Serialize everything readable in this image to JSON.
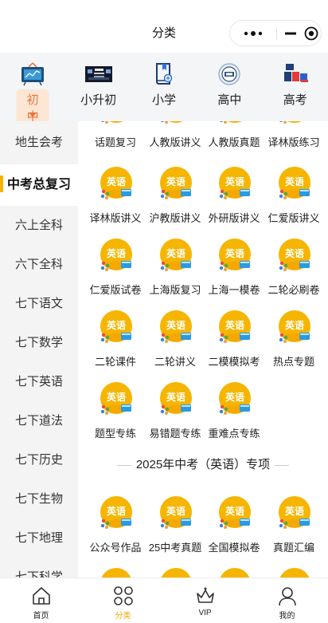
{
  "header": {
    "title": "分类"
  },
  "categories": [
    {
      "label": "初中",
      "icon": "blackboard-icon",
      "active": true
    },
    {
      "label": "小升初",
      "icon": "banner-image-icon"
    },
    {
      "label": "小学",
      "icon": "book-icon"
    },
    {
      "label": "高中",
      "icon": "high-school-icon"
    },
    {
      "label": "高考",
      "icon": "gaokao-icon"
    }
  ],
  "sidebar": {
    "items": [
      {
        "label": "地生会考"
      },
      {
        "label": "中考总复习",
        "active": true
      },
      {
        "label": "六上全科"
      },
      {
        "label": "六下全科"
      },
      {
        "label": "七下语文"
      },
      {
        "label": "七下数学"
      },
      {
        "label": "七下英语"
      },
      {
        "label": "七下道法"
      },
      {
        "label": "七下历史"
      },
      {
        "label": "七下生物"
      },
      {
        "label": "七下地理"
      },
      {
        "label": "七下科学"
      }
    ]
  },
  "main": {
    "badge_text": "英语",
    "top_partial_labels": [
      "话题复习",
      "人教版讲义",
      "人教版真题",
      "译林版练习"
    ],
    "tiles": [
      "译林版讲义",
      "沪教版讲义",
      "外研版讲义",
      "仁爱版讲义",
      "仁爱版试卷",
      "上海版复习",
      "上海一模卷",
      "二轮必刷卷",
      "二轮课件",
      "二轮讲义",
      "二模模拟考",
      "热点专题",
      "题型专练",
      "易错题专练",
      "重难点专练"
    ],
    "section2_title": "2025年中考（英语）专项",
    "section2_tiles": [
      "公众号作品",
      "25中考真题",
      "全国模拟卷",
      "真题汇编"
    ]
  },
  "tabbar": {
    "items": [
      {
        "label": "首页",
        "icon": "home-icon"
      },
      {
        "label": "分类",
        "icon": "category-icon",
        "active": true
      },
      {
        "label": "VIP",
        "icon": "crown-icon"
      },
      {
        "label": "我的",
        "icon": "user-icon"
      }
    ]
  },
  "colors": {
    "accent": "#f5b400",
    "active_orange": "#e8733a",
    "badge_blue": "#2a9be0"
  }
}
